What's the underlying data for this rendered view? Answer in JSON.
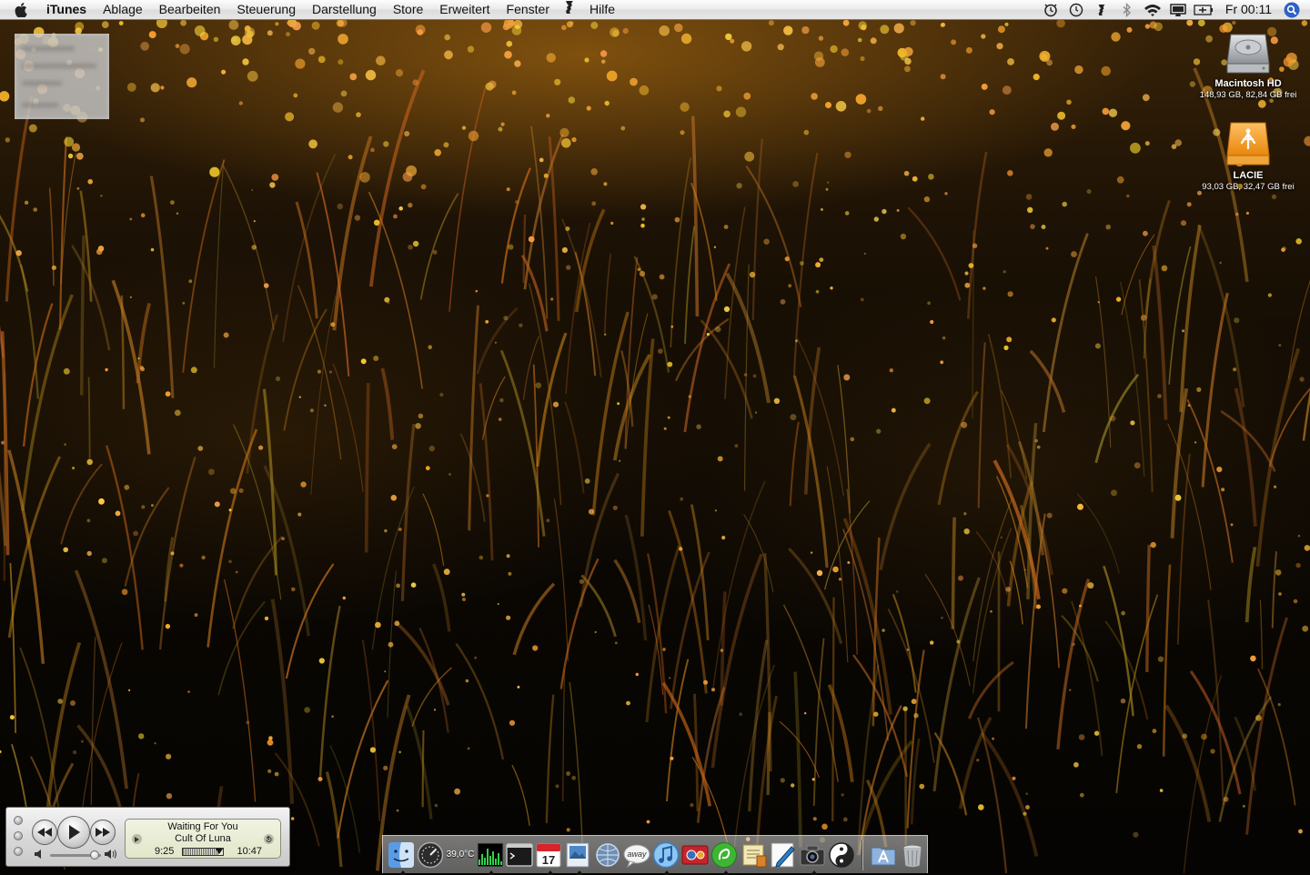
{
  "menubar": {
    "apple": "apple-icon",
    "app_name": "iTunes",
    "menus": [
      "Ablage",
      "Bearbeiten",
      "Steuerung",
      "Darstellung",
      "Store",
      "Erweitert",
      "Fenster",
      "Hilfe"
    ],
    "script_icon": "script-icon",
    "status_icons": [
      "timemachine-icon",
      "sync-icon",
      "script-icon",
      "bluetooth-icon",
      "wifi-icon",
      "display-icon",
      "battery-icon"
    ],
    "clock": "Fr 00:11",
    "spotlight": "spotlight-icon"
  },
  "desktop": {
    "drives": [
      {
        "name": "Macintosh HD",
        "info": "148,93 GB, 82,84 GB frei",
        "icon": "hard-drive-icon"
      },
      {
        "name": "LACIE",
        "info": "93,03 GB, 32,47 GB frei",
        "icon": "firewire-drive-icon"
      }
    ]
  },
  "mini_player": {
    "track": "Waiting For You",
    "artist": "Cult Of Luna",
    "elapsed": "9:25",
    "remaining": "10:47",
    "progress": 0.9,
    "volume": 0.88
  },
  "dock": {
    "temperature": "39,0°C",
    "calendar_day": "17",
    "apps": [
      "finder-icon",
      "dashboard-icon",
      "temperature-monitor",
      "activity-monitor-icon",
      "terminal-icon",
      "ical-icon",
      "preview-icon",
      "network-icon",
      "away-icon",
      "itunes-icon",
      "photobooth-icon",
      "adium-icon",
      "notes-icon",
      "pen-icon",
      "camera-icon",
      "yinyang-icon",
      "applications-folder-icon",
      "trash-icon"
    ]
  },
  "colors": {
    "wallpaper_amber": "#c78418",
    "menubar_bg": "#e9e9e9",
    "lcd_bg": "#e2e6c9",
    "lacie_orange": "#f39a1e"
  }
}
